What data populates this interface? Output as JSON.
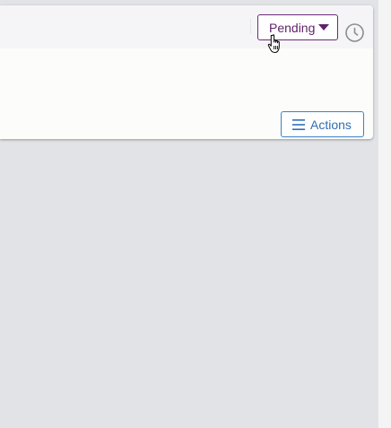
{
  "header": {
    "status_select": {
      "value": "Pending"
    },
    "history_icon": "clock-icon"
  },
  "card": {
    "actions_label": "Actions",
    "actions_icon": "hamburger-menu-icon"
  },
  "colors": {
    "status_accent": "#5e2468",
    "actions_accent": "#2f6fb3",
    "page_background": "#e2e3e6",
    "card_background": "#fcfcfb",
    "header_background": "#f5f5f7"
  },
  "pointer": "hand-pointer-cursor"
}
